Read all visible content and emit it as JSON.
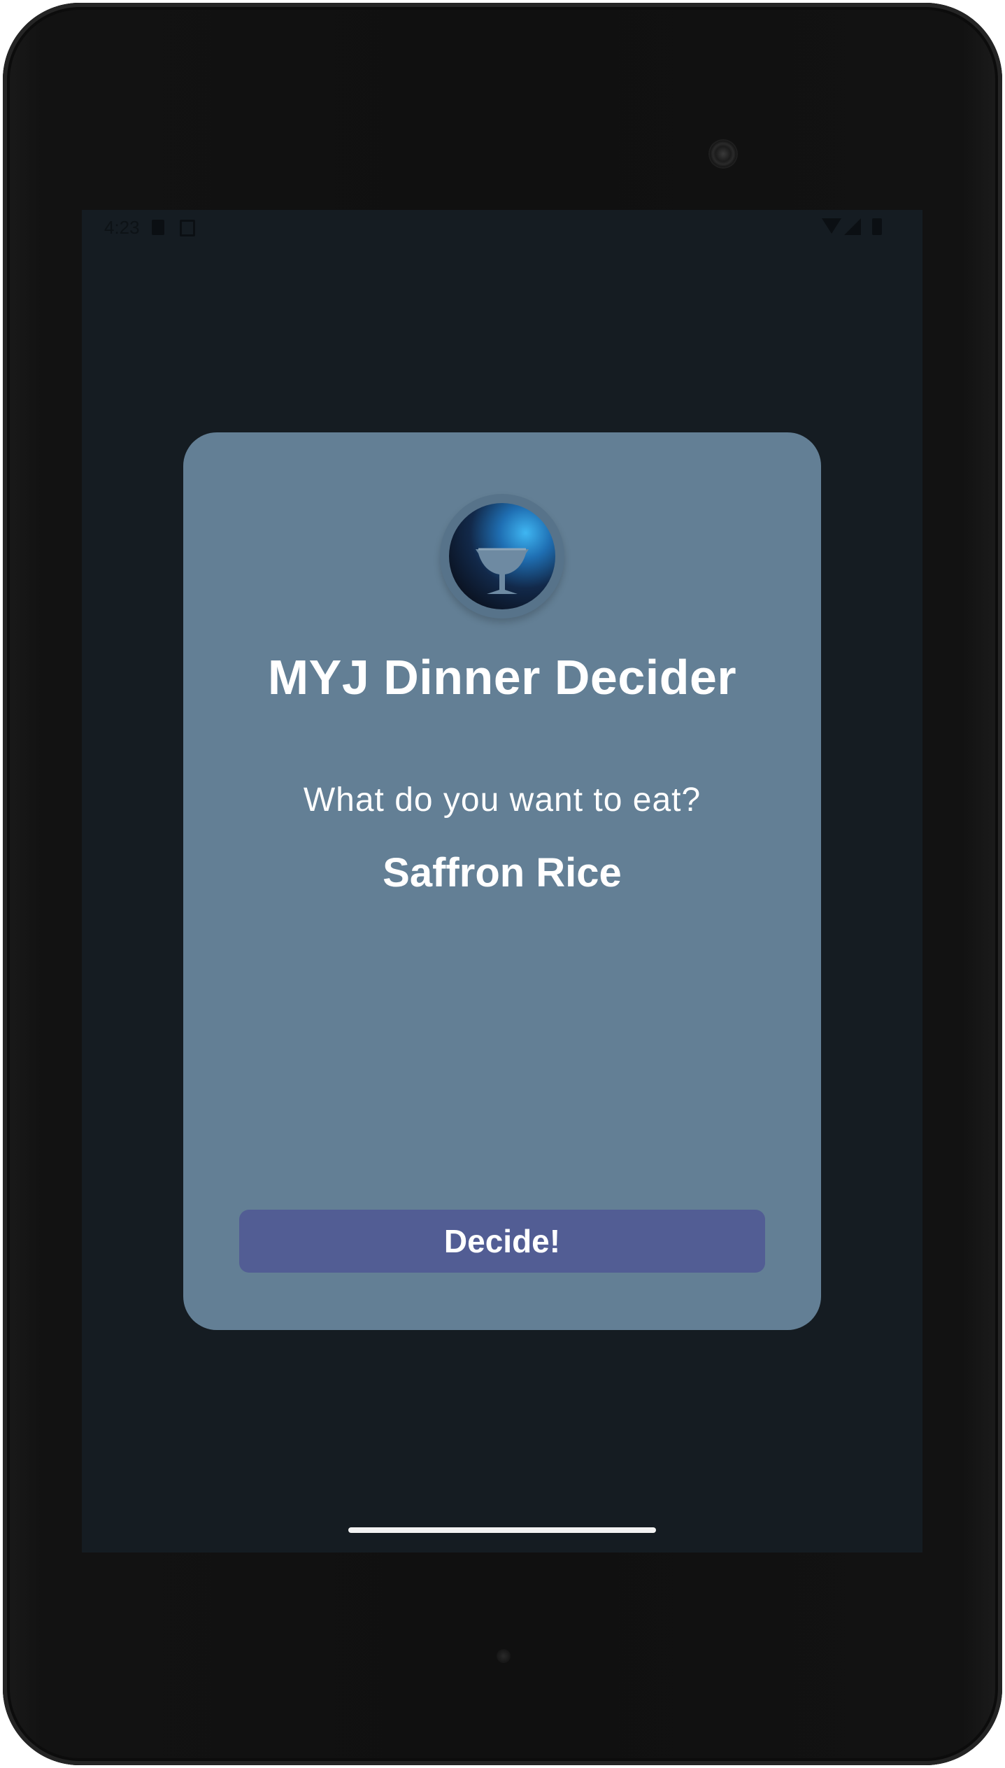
{
  "status_bar": {
    "time": "4:23"
  },
  "app": {
    "logo_icon": "cup-icon",
    "title": "MYJ Dinner Decider",
    "prompt": "What do you want to eat?",
    "result": "Saffron Rice",
    "decide_label": "Decide!"
  },
  "colors": {
    "screen_background": "#151c22",
    "card_background": "#637f95",
    "button_background": "#525d94",
    "text": "#ffffff"
  }
}
